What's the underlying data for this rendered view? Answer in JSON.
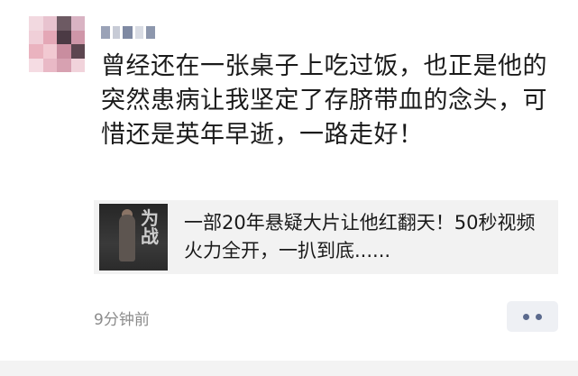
{
  "post": {
    "text": "曾经还在一张桌子上吃过饭，也正是他的突然患病让我坚定了存脐带血的念头，可惜还是英年早逝，一路走好！",
    "timestamp": "9分钟前"
  },
  "shared_link": {
    "title": "一部20年悬疑大片让他红翻天！50秒视频火力全开，一扒到底......",
    "thumbnail_text": "为战"
  },
  "more_button": {
    "icon": "more-dots-icon"
  },
  "colors": {
    "timestamp": "#8c8c8c",
    "more_dots": "#5b6a8d",
    "share_bg": "#f2f2f2"
  }
}
